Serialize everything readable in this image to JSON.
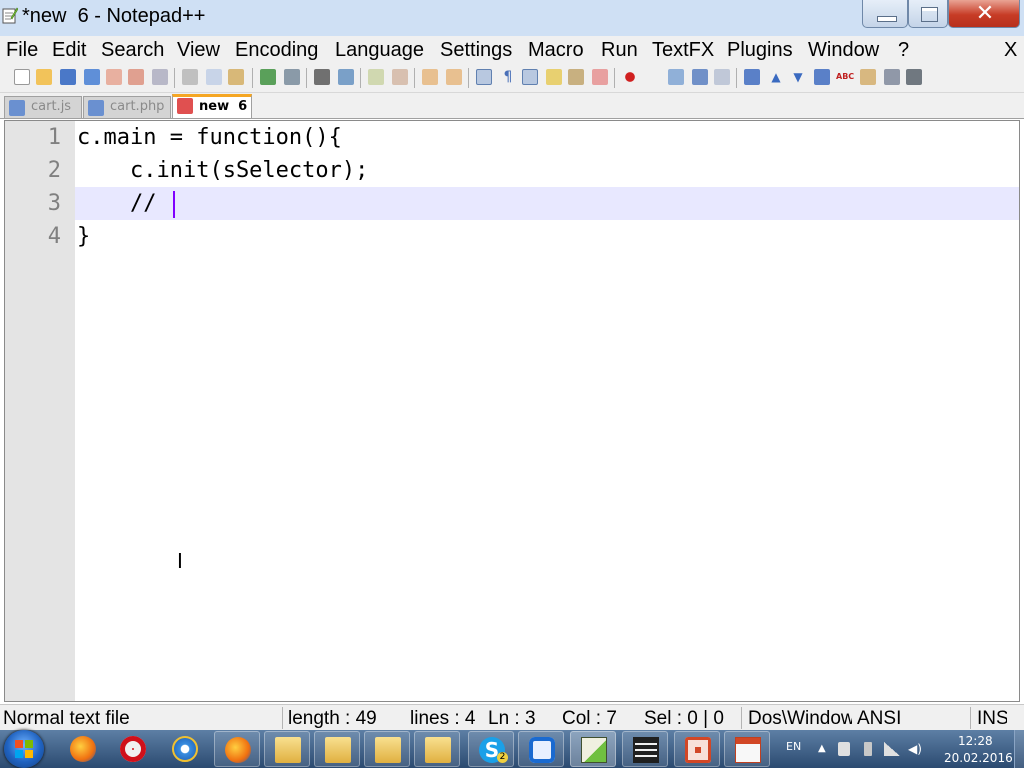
{
  "window": {
    "title": "*new  6 - Notepad++",
    "minimize_icon": "minimize-icon",
    "maximize_icon": "restore-icon",
    "close_glyph": "✕"
  },
  "menu": {
    "items": [
      "File",
      "Edit",
      "Search",
      "View",
      "Encoding",
      "Language",
      "Settings",
      "Macro",
      "Run",
      "TextFX",
      "Plugins",
      "Window",
      "?"
    ],
    "close_label": "X"
  },
  "toolbar": {
    "icons": [
      "new-file-icon",
      "open-file-icon",
      "save-icon",
      "save-all-icon",
      "close-icon",
      "close-all-icon",
      "print-icon",
      "cut-icon",
      "copy-icon",
      "paste-icon",
      "undo-icon",
      "redo-icon",
      "find-icon",
      "replace-icon",
      "zoom-in-icon",
      "zoom-out-icon",
      "sync-vertical-icon",
      "sync-horizontal-icon",
      "word-wrap-icon",
      "show-all-chars-icon",
      "indent-guide-icon",
      "user-lang-icon",
      "doc-map-icon",
      "function-list-icon",
      "record-macro-icon",
      "stop-macro-icon",
      "play-macro-icon",
      "run-macro-multiple-icon",
      "save-macro-icon",
      "textfx-collapse-icon",
      "textfx-up-icon",
      "textfx-down-icon",
      "textfx-expand-icon",
      "spell-check-icon",
      "textfx-tool-icon",
      "textfx-format-icon",
      "binoculars-icon"
    ]
  },
  "tabs": [
    {
      "label": "cart.js",
      "active": false
    },
    {
      "label": "cart.php",
      "active": false
    },
    {
      "label": "new  6",
      "active": true
    }
  ],
  "editor": {
    "line_numbers": [
      "1",
      "2",
      "3",
      "4"
    ],
    "lines": [
      "c.main = function(){",
      "    c.init(sSelector);",
      "    //",
      "}"
    ],
    "current_line": 3,
    "colors": {
      "current_line": "#e8e8ff",
      "caret": "#8000ff",
      "gutter": "#e4e4e4"
    }
  },
  "status": {
    "file_type": "Normal text file",
    "length": "length : 49",
    "lines": "lines : 4",
    "ln": "Ln : 3",
    "col": "Col : 7",
    "sel": "Sel : 0 | 0",
    "eol": "Dos\\Windows",
    "encoding": "ANSI",
    "mode": "INS"
  },
  "taskbar": {
    "apps": [
      "firefox-icon",
      "opera-icon",
      "internet-explorer-icon",
      "firefox-icon",
      "folder-icon",
      "folder-icon",
      "folder-icon",
      "folder-icon",
      "skype-icon",
      "teamviewer-icon",
      "notepadpp-icon",
      "video-icon",
      "powerpoint-icon",
      "powerpoint-icon"
    ],
    "skype_badge": "2",
    "tray": {
      "language": "EN",
      "time": "12:28",
      "date": "20.02.2016"
    }
  }
}
